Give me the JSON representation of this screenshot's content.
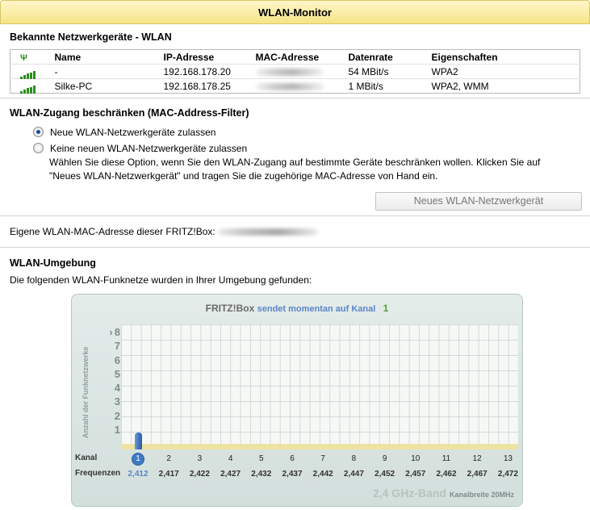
{
  "window": {
    "title": "WLAN-Monitor"
  },
  "devices": {
    "heading": "Bekannte Netzwerkgeräte - WLAN",
    "columns": [
      "Name",
      "IP-Adresse",
      "MAC-Adresse",
      "Datenrate",
      "Eigenschaften"
    ],
    "rows": [
      {
        "name": "-",
        "ip": "192.168.178.20",
        "rate": "54 MBit/s",
        "props": "WPA2"
      },
      {
        "name": "Silke-PC",
        "ip": "192.168.178.25",
        "rate": "1 MBit/s",
        "props": "WPA2, WMM"
      }
    ]
  },
  "filter": {
    "heading": "WLAN-Zugang beschränken (MAC-Address-Filter)",
    "option_allow": "Neue WLAN-Netzwerkgeräte zulassen",
    "option_deny": "Keine neuen WLAN-Netzwerkgeräte zulassen",
    "selected": "allow",
    "description_1": "Wählen Sie diese Option, wenn Sie den WLAN-Zugang auf bestimmte Geräte beschränken wollen. Klicken Sie auf",
    "description_2": "\"Neues WLAN-Netzwerkgerät\" und tragen Sie die zugehörige MAC-Adresse von Hand ein.",
    "new_device_button": "Neues WLAN-Netzwerkgerät"
  },
  "own_mac": {
    "label": "Eigene WLAN-MAC-Adresse dieser FRITZ!Box:"
  },
  "environment": {
    "heading": "WLAN-Umgebung",
    "subtitle": "Die folgenden WLAN-Funknetze wurden in Ihrer Umgebung gefunden:"
  },
  "chart_data": {
    "type": "bar",
    "title_brand": "FRITZ!Box",
    "title_text": "sendet momentan auf Kanal",
    "current_channel": "1",
    "ylabel": "Anzahl der Funknetzwerke",
    "ylim": [
      0,
      8
    ],
    "yticks": [
      "1",
      "2",
      "3",
      "4",
      "5",
      "6",
      "7",
      "8"
    ],
    "row_label_channel": "Kanal",
    "row_label_freq": "Frequenzen",
    "categories": [
      "1",
      "2",
      "3",
      "4",
      "5",
      "6",
      "7",
      "8",
      "9",
      "10",
      "11",
      "12",
      "13"
    ],
    "frequencies": [
      "2,412",
      "2,417",
      "2,422",
      "2,427",
      "2,432",
      "2,437",
      "2,442",
      "2,447",
      "2,452",
      "2,457",
      "2,462",
      "2,467",
      "2,472"
    ],
    "values": [
      1,
      0,
      0,
      0,
      0,
      0,
      0,
      0,
      0,
      0,
      0,
      0,
      0
    ],
    "band_label": "2,4 GHz-Band",
    "width_label": "Kanalbreite 20MHz",
    "colors": {
      "bar": "#3e73b8",
      "current_channel": "#51a336"
    }
  }
}
